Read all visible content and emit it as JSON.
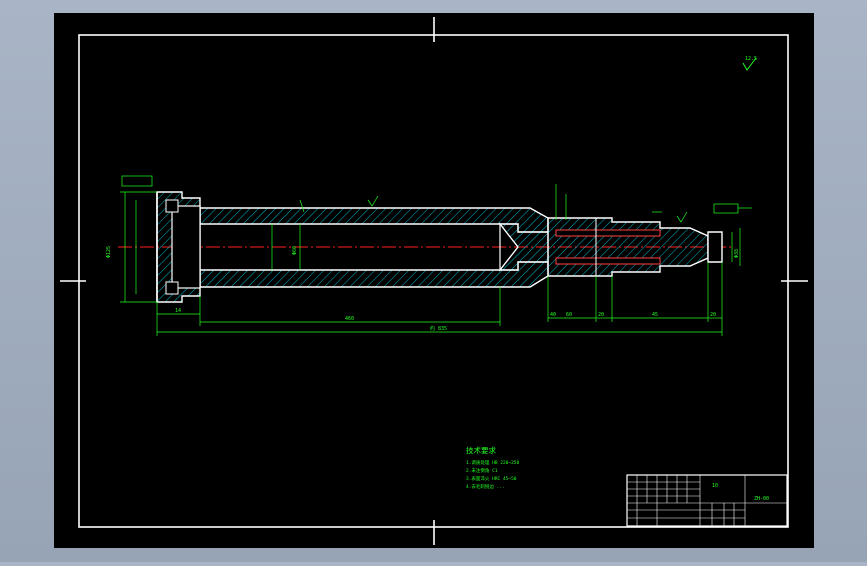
{
  "colors": {
    "app_background": "#a9b5c6",
    "canvas": "#000000",
    "frame": "#ffffff",
    "geometry": "#ffffff",
    "hatch": "#00e5ff",
    "dimension": "#22ff22",
    "center_line": "#ff2020",
    "titleblock_text": "#22ff22"
  },
  "drawing": {
    "roughness_mark": "12.5",
    "dimensions": {
      "length_mid": "460",
      "length_total": "约 835",
      "seg_a": "40",
      "seg_b": "60",
      "seg_c": "20",
      "seg_d": "45",
      "seg_e": "65",
      "seg_f": "20",
      "left_len": "14",
      "left_dia": "Φ125",
      "right_dia": "Φ38",
      "inner_dia": "Φ60"
    },
    "notes": {
      "title": "技术要求",
      "lines": [
        "1.调质处理 HB 220~250",
        "2.未注倒角 C1",
        "3.表面淬火 HRC 45~50",
        "4.去毛刺锐边 ..."
      ]
    },
    "title_block": {
      "part_code": "10",
      "drawing_no": "ZH-00"
    }
  }
}
